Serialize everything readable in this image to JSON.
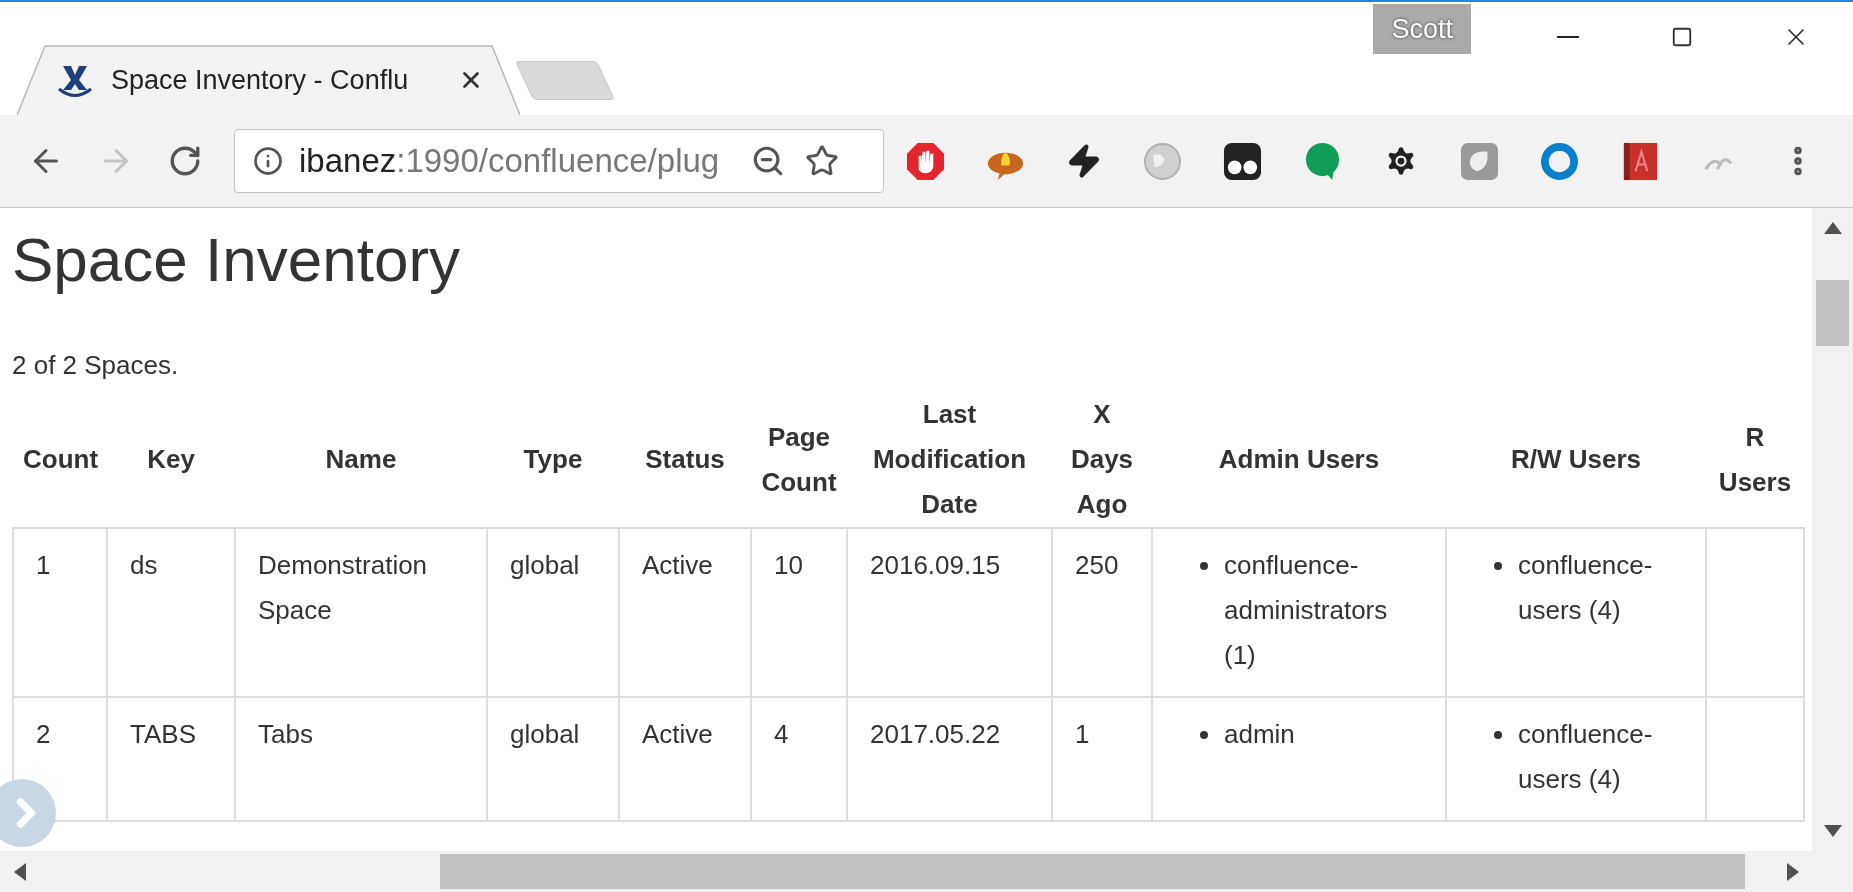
{
  "browser": {
    "tab": {
      "title": "Space Inventory - Conflu",
      "selected": true
    },
    "profile": "Scott",
    "address": {
      "host": "ibanez",
      "rest": ":1990/confluence/plug"
    }
  },
  "page": {
    "heading": "Space Inventory",
    "summary": "2 of 2 Spaces."
  },
  "table": {
    "columns": [
      "Count",
      "Key",
      "Name",
      "Type",
      "Status",
      "Page Count",
      "Last Modification Date",
      "X Days Ago",
      "Admin Users",
      "R/W Users",
      "R Users"
    ],
    "rows": [
      {
        "count": "1",
        "key": "ds",
        "name": "Demonstration Space",
        "type": "global",
        "status": "Active",
        "page_count": "10",
        "last_modified": "2016.09.15",
        "days_ago": "250",
        "admin_users": [
          "confluence-administrators (1)"
        ],
        "rw_users": [
          "confluence-users (4)"
        ]
      },
      {
        "count": "2",
        "key": "TABS",
        "name": "Tabs",
        "type": "global",
        "status": "Active",
        "page_count": "4",
        "last_modified": "2017.05.22",
        "days_ago": "1",
        "admin_users": [
          "admin"
        ],
        "rw_users": [
          "confluence-users (4)"
        ]
      }
    ]
  }
}
